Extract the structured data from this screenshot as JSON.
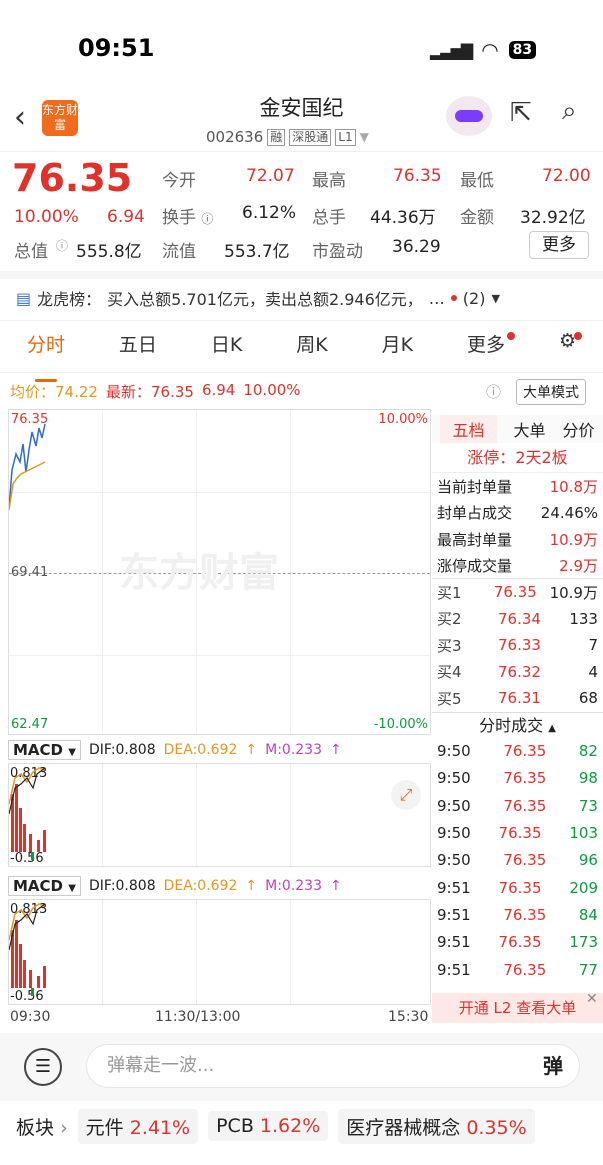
{
  "status": {
    "time": "09:51",
    "battery": "83"
  },
  "header": {
    "logo": "东方财富",
    "name": "金安国纪",
    "code": "002636",
    "tags": [
      "融",
      "深股通",
      "L1"
    ]
  },
  "quote": {
    "price": "76.35",
    "pct": "10.00%",
    "chg": "6.94",
    "cells": [
      [
        "今开",
        "72.07",
        "最高",
        "76.35",
        "最低",
        "72.00"
      ],
      [
        "换手",
        "6.12%",
        "总手",
        "44.36万",
        "金额",
        "32.92亿"
      ],
      [
        "总值",
        "555.8亿",
        "流值",
        "553.7亿",
        "市盈动",
        "36.29"
      ]
    ],
    "more": "更多"
  },
  "lhb": {
    "label": "龙虎榜：",
    "text": "买入总额5.701亿元，卖出总额2.946亿元，",
    "ellipsis": "…",
    "count": "(2)"
  },
  "tabs": [
    "分时",
    "五日",
    "日K",
    "周K",
    "月K",
    "更多"
  ],
  "avg": {
    "avg_label": "均价：",
    "avg": "74.22",
    "latest_label": "最新：",
    "latest": "76.35",
    "chg": "6.94",
    "pct": "10.00%",
    "mode": "大单模式"
  },
  "chart": {
    "top": "76.35",
    "top_pct": "10.00%",
    "mid": "69.41",
    "bottom": "62.47",
    "bottom_pct": "-10.00%",
    "watermark": "东方财富",
    "times": [
      "09:30",
      "11:30/13:00",
      "15:30"
    ]
  },
  "macd": {
    "name": "MACD",
    "dif": "DIF:0.808",
    "dea": "DEA:0.692",
    "m": "M:0.233",
    "top": "0.813",
    "bottom": "-0.56"
  },
  "panel": {
    "tabs": [
      "五档",
      "大单",
      "分价"
    ],
    "limit": "涨停：",
    "limit_val": "2天2板",
    "stats": [
      [
        "当前封单量",
        "10.8万"
      ],
      [
        "封单占成交",
        "24.46%"
      ],
      [
        "最高封单量",
        "10.9万"
      ],
      [
        "涨停成交量",
        "2.9万"
      ]
    ],
    "bids": [
      [
        "买1",
        "76.35",
        "10.9万"
      ],
      [
        "买2",
        "76.34",
        "133"
      ],
      [
        "买3",
        "76.33",
        "7"
      ],
      [
        "买4",
        "76.32",
        "4"
      ],
      [
        "买5",
        "76.31",
        "68"
      ]
    ],
    "ticks_title": "分时成交",
    "ticks": [
      [
        "9:50",
        "76.35",
        "82"
      ],
      [
        "9:50",
        "76.35",
        "98"
      ],
      [
        "9:50",
        "76.35",
        "73"
      ],
      [
        "9:50",
        "76.35",
        "103"
      ],
      [
        "9:50",
        "76.35",
        "96"
      ],
      [
        "9:51",
        "76.35",
        "209"
      ],
      [
        "9:51",
        "76.35",
        "84"
      ],
      [
        "9:51",
        "76.35",
        "173"
      ],
      [
        "9:51",
        "76.35",
        "77"
      ]
    ],
    "l2": "开通 L2 查看大单"
  },
  "input": {
    "placeholder": "弹幕走一波...",
    "danmu": "弹"
  },
  "sectors": {
    "label": "板块",
    "items": [
      [
        "元件",
        "2.41%"
      ],
      [
        "PCB",
        "1.62%"
      ],
      [
        "医疗器械概念",
        "0.35%"
      ]
    ]
  }
}
